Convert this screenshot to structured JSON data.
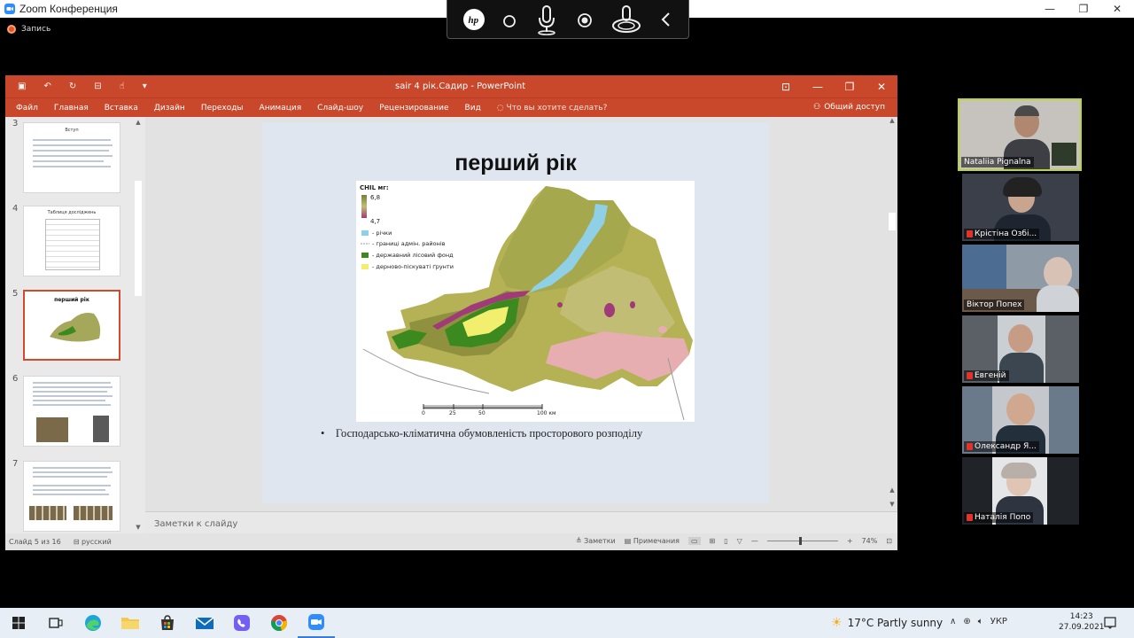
{
  "zoom": {
    "window_title": "Zoom Конференция",
    "record_label": "Запись"
  },
  "ppt": {
    "doc_title": "sair 4 рік.Садир - PowerPoint",
    "ribbon_tabs": [
      "Файл",
      "Главная",
      "Вставка",
      "Дизайн",
      "Переходы",
      "Анимация",
      "Слайд-шоу",
      "Рецензирование",
      "Вид"
    ],
    "search_placeholder": "Что вы хотите сделать?",
    "share_label": "Общий доступ",
    "thumb_numbers": [
      "3",
      "4",
      "5",
      "6",
      "7"
    ],
    "thumb_titles": [
      "Вступ",
      "Таблиця досліджень",
      "перший рік",
      "",
      ""
    ],
    "slide_title": "перший рік",
    "map": {
      "legend_title": "СНІL мг:",
      "legend_high": "6,8",
      "legend_low": "4,7",
      "legend_items": [
        "- річки",
        "- границі адмін. районів",
        "- державний лісовий фонд",
        "- дерново-піскуваті ґрунти"
      ],
      "scale_ticks": [
        "0",
        "25",
        "50",
        "100 км"
      ],
      "colors": {
        "low": "#b5b256",
        "high": "#7a7d3a",
        "river": "#8fd0e6",
        "forest": "#3c8a1f",
        "sand": "#f2ef6e",
        "pink": "#e6aeb0",
        "mauve": "#a03a78"
      }
    },
    "bullet_text": "Господарсько-кліматична обумовленість просторового розподілу",
    "notes_placeholder": "Заметки к слайду",
    "status_slide": "Слайд 5 из 16",
    "status_lang": "русский",
    "status_notes": "Заметки",
    "status_comments": "Примечания",
    "zoom_level": "74%"
  },
  "participants": [
    {
      "name": "Nataliia Pignalna",
      "active": true
    },
    {
      "name": "Крістіна Озбі...",
      "active": false
    },
    {
      "name": "Віктор Попех",
      "active": false
    },
    {
      "name": "Евгеній",
      "active": false
    },
    {
      "name": "Олександр Я...",
      "active": false
    },
    {
      "name": "Наталія Попо",
      "active": false
    }
  ],
  "taskbar": {
    "weather": "17°C  Partly sunny",
    "lang": "УКР",
    "time": "14:23",
    "date": "27.09.2021"
  },
  "theme": {
    "ppt_accent": "#c9472b",
    "active_speaker": "#b9d635"
  }
}
